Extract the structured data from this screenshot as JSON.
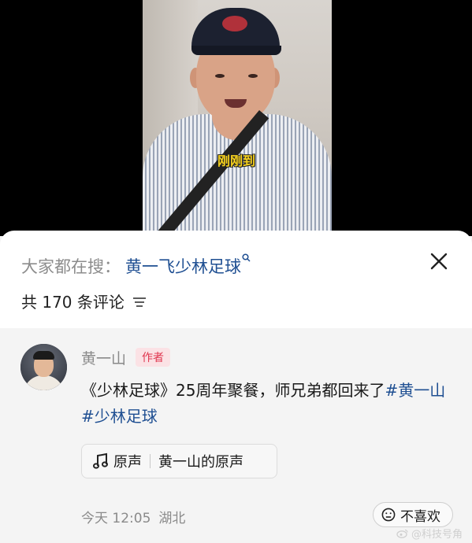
{
  "video": {
    "caption": "刚刚到"
  },
  "search": {
    "prefix": "大家都在搜：",
    "term": "黄一飞少林足球"
  },
  "comments_header": {
    "count_text": "共 170 条评论"
  },
  "comment": {
    "author": "黄一山",
    "badge": "作者",
    "text_plain": "《少林足球》25周年聚餐，师兄弟都回来了",
    "hashtag1": "#黄一山",
    "hashtag2": "#少林足球",
    "sound": {
      "label": "原声",
      "source": "黄一山的原声"
    },
    "time": "今天 12:05",
    "location": "湖北",
    "dislike_label": "不喜欢"
  },
  "watermark": "@科技号角"
}
